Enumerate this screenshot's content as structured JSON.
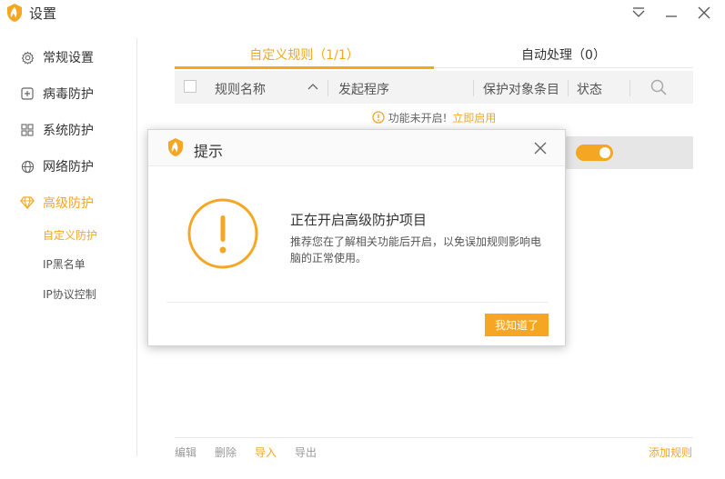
{
  "window": {
    "title": "设置"
  },
  "sidebar": {
    "items": [
      {
        "label": "常规设置",
        "icon": "gear-icon"
      },
      {
        "label": "病毒防护",
        "icon": "plus-square-icon"
      },
      {
        "label": "系统防护",
        "icon": "grid-icon"
      },
      {
        "label": "网络防护",
        "icon": "globe-icon"
      },
      {
        "label": "高级防护",
        "icon": "diamond-icon",
        "active": true
      }
    ],
    "subitems": [
      {
        "label": "自定义防护",
        "active": true
      },
      {
        "label": "IP黑名单"
      },
      {
        "label": "IP协议控制"
      }
    ]
  },
  "tabs": [
    {
      "label": "自定义规则（1/1）",
      "active": true
    },
    {
      "label": "自动处理（0）"
    }
  ],
  "table": {
    "headers": [
      "规则名称",
      "发起程序",
      "保护对象条目",
      "状态"
    ]
  },
  "notice": {
    "text": "功能未开启!",
    "link": "立即启用"
  },
  "footer": {
    "edit": "编辑",
    "delete": "删除",
    "import": "导入",
    "export": "导出",
    "add_rule": "添加规则"
  },
  "dialog": {
    "title": "提示",
    "heading": "正在开启高级防护项目",
    "line1": "推荐您在了解相关功能后开启，以免误加规则影响电",
    "line2": "脑的正常使用。",
    "ok": "我知道了"
  },
  "colors": {
    "accent": "#f5a623"
  }
}
